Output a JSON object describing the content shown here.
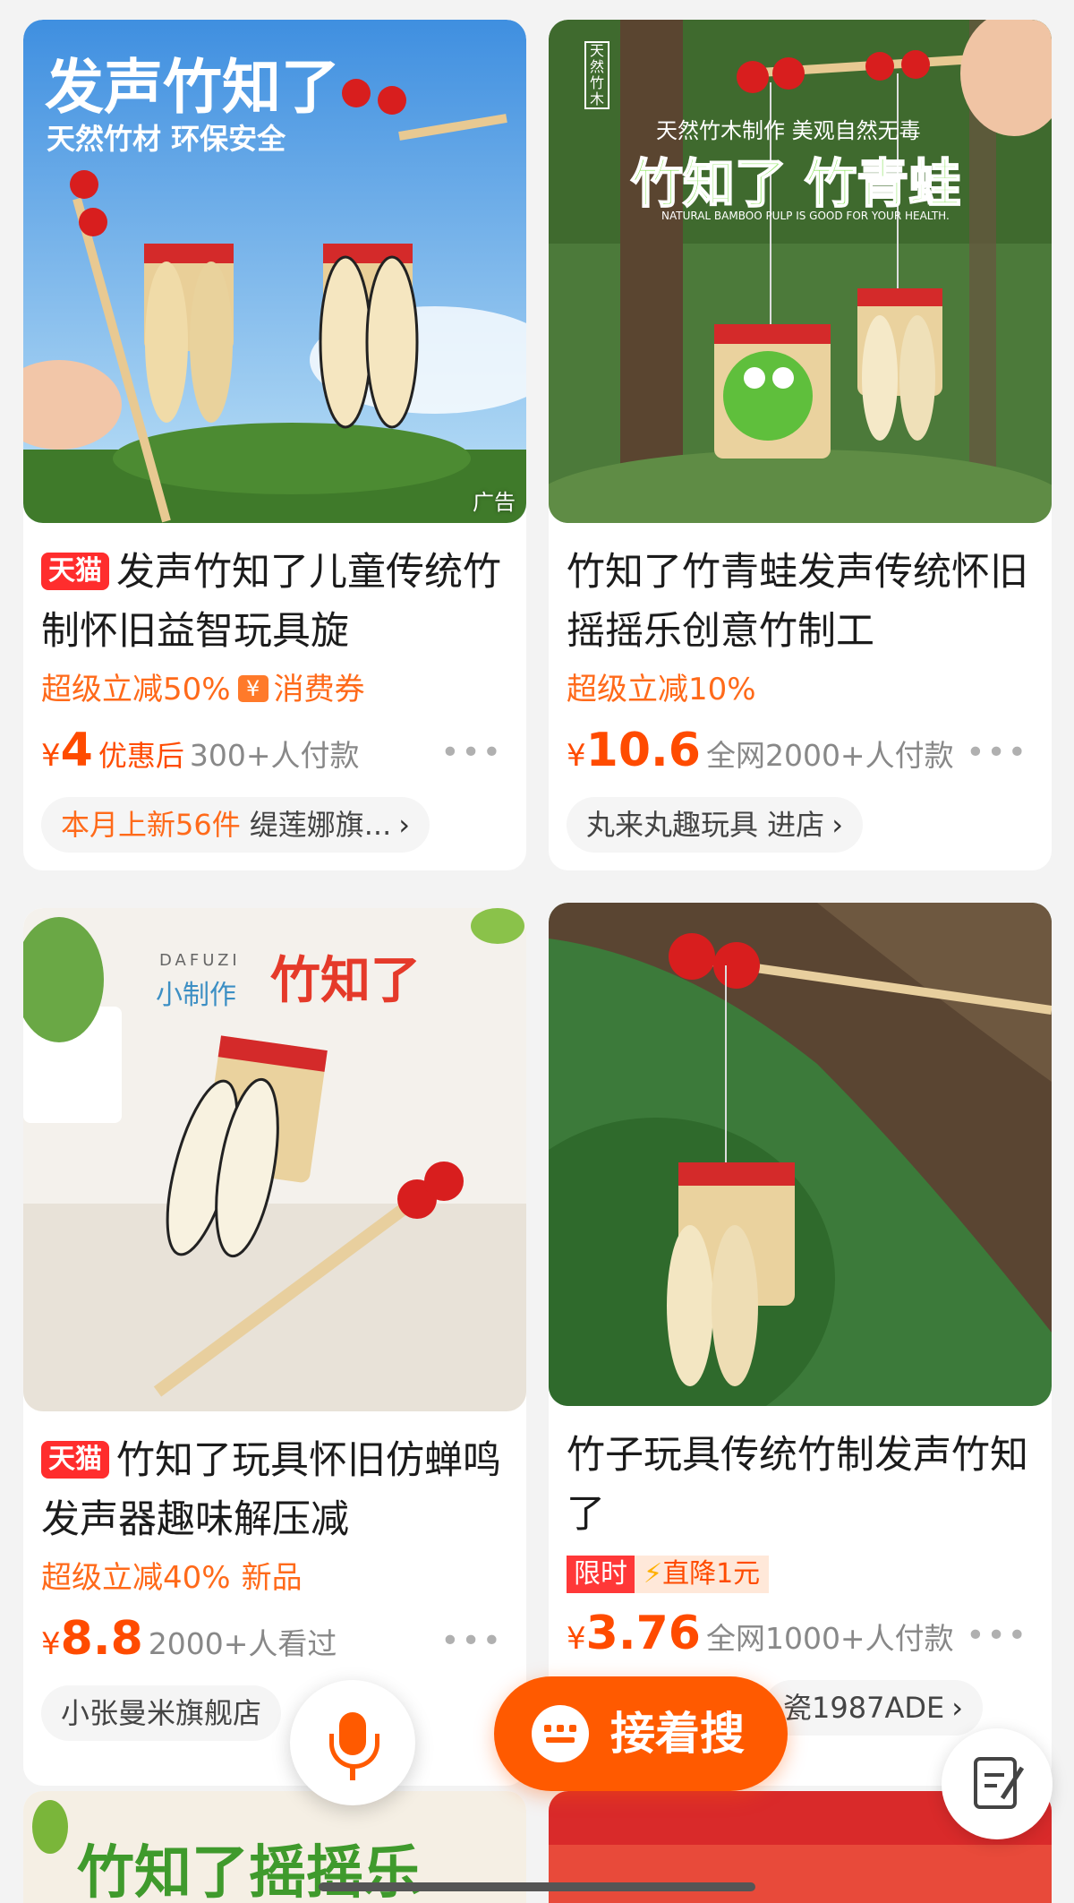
{
  "products": [
    {
      "tag": "天猫",
      "title": "发声竹知了儿童传统竹制怀旧益智玩具旋",
      "promo": "超级立减50%",
      "coupon_label": "消费券",
      "price_symbol": "¥",
      "price": "4",
      "price_note": "优惠后",
      "sales": "300+人付款",
      "shop_highlight": "本月上新56件",
      "shop": "缇莲娜旗...",
      "image_headline": "发声竹知了",
      "image_sub": "天然竹材 环保安全",
      "ad_label": "广告"
    },
    {
      "title": "竹知了竹青蛙发声传统怀旧摇摇乐创意竹制工",
      "promo": "超级立减10%",
      "price_symbol": "¥",
      "price": "10.6",
      "sales": "全网2000+人付款",
      "shop": "丸来丸趣玩具 进店",
      "image_headline": "竹知了 竹青蛙",
      "image_sub": "天然竹木制作 美观自然无毒",
      "image_tiny": "NATURAL BAMBOO PULP IS GOOD FOR YOUR HEALTH.",
      "image_badge": "天然竹木"
    },
    {
      "tag": "天猫",
      "title": "竹知了玩具怀旧仿蝉鸣发声器趣味解压减",
      "promo": "超级立减40%",
      "promo_extra": "新品",
      "price_symbol": "¥",
      "price": "8.8",
      "sales": "2000+人看过",
      "shop": "小张曼米旗舰店",
      "image_brand": "DAFUZI",
      "image_small": "小制作",
      "image_headline": "竹知了"
    },
    {
      "title": "竹子玩具传统竹制发声竹知了",
      "limit_a": "限时",
      "limit_b": "直降1元",
      "price_symbol": "¥",
      "price": "3.76",
      "sales": "全网1000+人付款",
      "shop": "瓷1987ADE"
    }
  ],
  "more_dots": "•••",
  "chevron": "›",
  "search_button_label": "接着搜",
  "next_row_partial_text": "竹知了摇摇乐"
}
